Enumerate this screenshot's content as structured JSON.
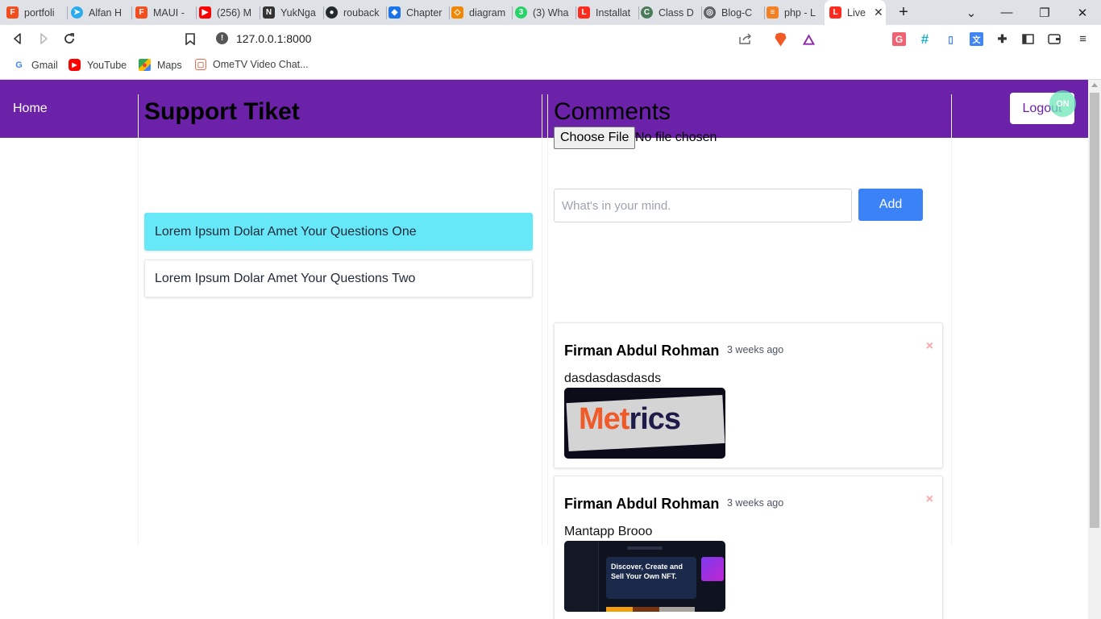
{
  "browser": {
    "tabs": [
      {
        "title": "portfoli",
        "icon": "figma-icon",
        "color": "#f24e1e"
      },
      {
        "title": "Alfan H",
        "icon": "telegram-icon",
        "color": "#2aabee"
      },
      {
        "title": "MAUI -",
        "icon": "figma-icon",
        "color": "#f24e1e"
      },
      {
        "title": "(256) M",
        "icon": "youtube-icon",
        "color": "#ff0000"
      },
      {
        "title": "YukNga",
        "icon": "notion-icon",
        "color": "#333333"
      },
      {
        "title": "rouback",
        "icon": "github-icon",
        "color": "#24292e"
      },
      {
        "title": "Chapter",
        "icon": "classroom-icon",
        "color": "#1a73e8"
      },
      {
        "title": "diagram",
        "icon": "diagrams-icon",
        "color": "#f08705"
      },
      {
        "title": "(3) Wha",
        "icon": "whatsapp-icon",
        "color": "#25d366"
      },
      {
        "title": "Installat",
        "icon": "laravel-icon",
        "color": "#ff2d20"
      },
      {
        "title": "Class D",
        "icon": "site-icon",
        "color": "#4a7c59"
      },
      {
        "title": "Blog-C",
        "icon": "globe-icon",
        "color": "#5f6368"
      },
      {
        "title": "php - L",
        "icon": "stackoverflow-icon",
        "color": "#f48024"
      },
      {
        "title": "Live",
        "icon": "laravel-icon",
        "color": "#ff2d20"
      }
    ],
    "url": "127.0.0.1:8000",
    "bookmarks": [
      {
        "label": "Gmail",
        "icon": "google-icon"
      },
      {
        "label": "YouTube",
        "icon": "youtube-icon"
      },
      {
        "label": "Maps",
        "icon": "maps-icon"
      },
      {
        "label": "OmeTV Video Chat...",
        "icon": "ometv-icon"
      }
    ]
  },
  "nav": {
    "home_label": "Home",
    "logout_label": "Logout",
    "status_badge": "ON",
    "brand_color": "#6b21a8"
  },
  "support": {
    "title": "Support Tiket",
    "tickets": [
      {
        "label": "Lorem Ipsum Dolar Amet Your Questions One",
        "active": true
      },
      {
        "label": "Lorem Ipsum Dolar Amet Your Questions Two",
        "active": false
      }
    ]
  },
  "comments": {
    "title": "Comments",
    "file_button_label": "Choose File",
    "file_status": "No file chosen",
    "input_placeholder": "What's in your mind.",
    "input_value": "",
    "add_label": "Add",
    "delete_symbol": "×",
    "items": [
      {
        "author": "Firman Abdul Rohman",
        "time": "3 weeks ago",
        "body": "dasdasdasdasds",
        "image_text_1": "Met",
        "image_text_2": "rics"
      },
      {
        "author": "Firman Abdul Rohman",
        "time": "3 weeks ago",
        "body": "Mantapp Brooo",
        "image_text": "Discover, Create and Sell Your Own NFT."
      }
    ]
  }
}
